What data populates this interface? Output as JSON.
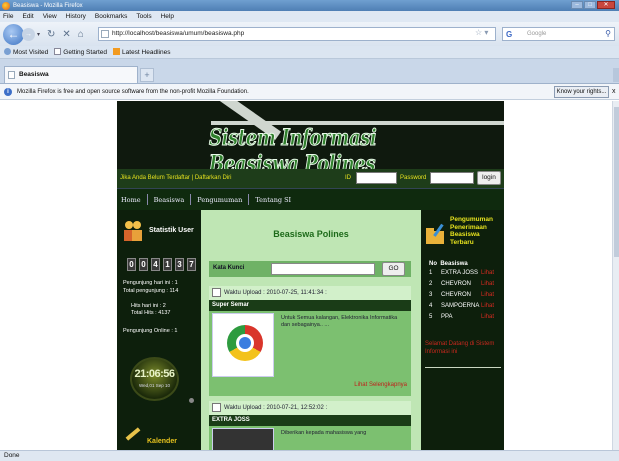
{
  "window": {
    "title": "Beasiswa - Mozilla Firefox",
    "controls": [
      "–",
      "□",
      "✕"
    ]
  },
  "menu": [
    "File",
    "Edit",
    "View",
    "History",
    "Bookmarks",
    "Tools",
    "Help"
  ],
  "nav": {
    "url": "http://localhost/beasiswa/umum/beasiswa.php",
    "search_engine": "Google"
  },
  "bookmarks": [
    "Most Visited",
    "Getting Started",
    "Latest Headlines"
  ],
  "tab": {
    "label": "Beasiswa",
    "new_tab": "+"
  },
  "notification": {
    "text": "Mozilla Firefox is free and open source software from the non-profit Mozilla Foundation.",
    "button": "Know your rights...",
    "close": "x"
  },
  "status": "Done",
  "site": {
    "title": "Sistem Informasi Beasiswa Polines",
    "login": {
      "register_text": "Jika Anda Belum Terdaftar | Daftarkan Diri",
      "id_label": "ID",
      "password_label": "Password",
      "login_button": "login"
    },
    "menu": [
      "Home",
      "Beasiswa",
      "Pengumuman",
      "Tentang SI"
    ],
    "stats": {
      "title": "Statistik User",
      "counter": [
        "0",
        "0",
        "4",
        "1",
        "3",
        "7"
      ],
      "visitors_today": "Pengunjung hari ini : 1",
      "visitors_total": "Total pengunjung : 114",
      "hits_today": "Hits hari ini : 2",
      "hits_total": "Total Hits : 4137",
      "online": "Pengunjung Online : 1",
      "clock_time": "21:06:56",
      "clock_date": "Wed,01 Sep 10",
      "calendar_title": "Kalender"
    },
    "main": {
      "heading": "Beasiswa Polines",
      "search_label": "Kata Kunci",
      "search_button": "GO",
      "items": [
        {
          "upload": "Waktu Upload : 2010-07-25, 11:41:34 :",
          "name": "Super Semar",
          "desc": "Untuk Semua kalangan, Elektronika Informatika dan sebagainya.. ...",
          "more": "Lihat Selengkapnya"
        },
        {
          "upload": "Waktu Upload : 2010-07-21, 12:52:02 :",
          "name": "EXTRA JOSS",
          "desc": "Diberikan kepada mahasiswa yang"
        }
      ]
    },
    "announcements": {
      "title_lines": [
        "Pengumuman",
        "Penerimaan",
        "Beasiswa",
        "Terbaru"
      ],
      "col_no": "No",
      "col_name": "Beasiswa",
      "rows": [
        {
          "no": "1",
          "name": "EXTRA JOSS",
          "action": "Lihat"
        },
        {
          "no": "2",
          "name": "CHEVRON",
          "action": "Lihat"
        },
        {
          "no": "3",
          "name": "CHEVRON",
          "action": "Lihat"
        },
        {
          "no": "4",
          "name": "SAMPOERNA",
          "action": "Lihat"
        },
        {
          "no": "5",
          "name": "PPA",
          "action": "Lihat"
        }
      ],
      "welcome": "Selamat Datang di Sistem Informasi ini"
    }
  }
}
